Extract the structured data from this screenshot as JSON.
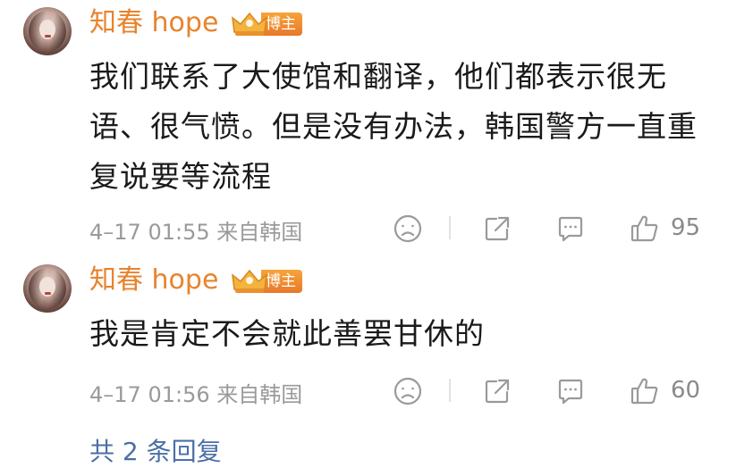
{
  "comments": [
    {
      "username": "知春 hope",
      "badge": "博主",
      "text": "我们联系了大使馆和翻译，他们都表示很无语、很气愤。但是没有办法，韩国警方一直重复说要等流程",
      "time": "4–17 01:55",
      "location": "来自韩国",
      "likes": "95"
    },
    {
      "username": "知春 hope",
      "badge": "博主",
      "text": "我是肯定不会就此善罢甘休的",
      "time": "4–17 01:56",
      "location": "来自韩国",
      "likes": "60"
    }
  ],
  "footer": {
    "more_replies": "共 2 条回复"
  },
  "colors": {
    "username": "#e8832d",
    "badge_bg": "#f0902f",
    "text": "#1a1a1a",
    "meta": "#9a9a9a",
    "icon": "#9a9a9a"
  },
  "icons": [
    "emoji-icon",
    "share-icon",
    "reply-icon",
    "like-icon",
    "crown-icon"
  ]
}
